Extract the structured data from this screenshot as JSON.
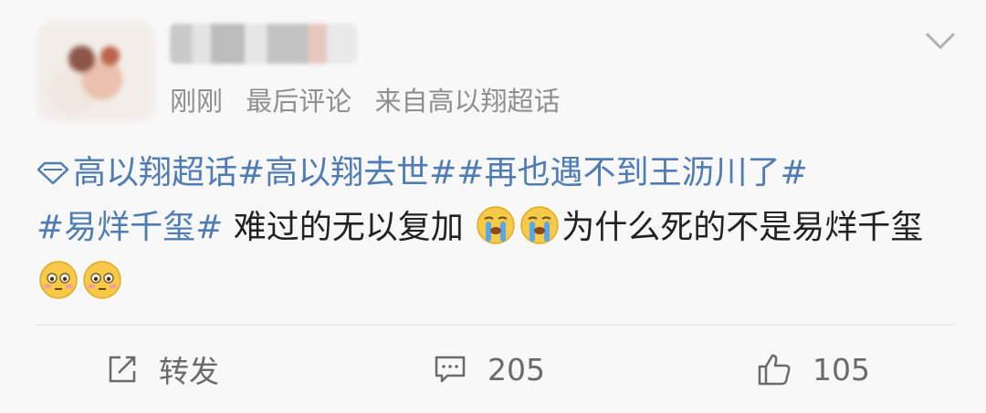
{
  "post": {
    "meta": {
      "time": "刚刚",
      "last_comment": "最后评论",
      "source": "来自高以翔超话"
    },
    "content": {
      "topic_1": "高以翔超话",
      "topic_2": "#高以翔去世#",
      "topic_3": "#再也遇不到王沥川了#",
      "topic_4": "#易烊千玺#",
      "text_1": " 难过的无以复加 ",
      "text_2": "为什么死的不是易烊千玺 "
    },
    "actions": {
      "repost_label": "转发",
      "comment_count": "205",
      "like_count": "105"
    }
  },
  "icons": {
    "topic": "diamond-icon",
    "crying_emoji": "crying-face-icon",
    "flushed_emoji": "flushed-face-icon",
    "menu": "chevron-down-icon",
    "repost": "share-icon",
    "comment": "comment-icon",
    "like": "thumbs-up-icon"
  },
  "colors": {
    "topic": "#4f7cb3",
    "text": "#222222",
    "muted": "#8f8f8f"
  }
}
